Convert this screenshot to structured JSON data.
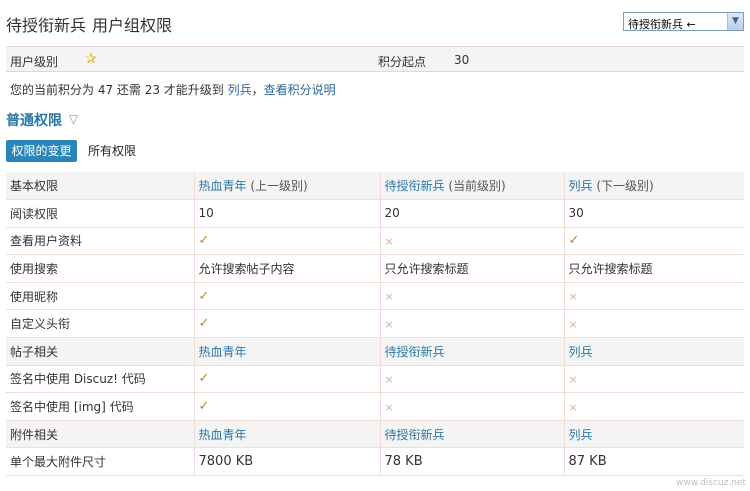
{
  "header": {
    "title": "待授衔新兵",
    "subtitle": "用户组权限",
    "group_select": {
      "value": "待授衔新兵 ←",
      "arrow": "▼"
    }
  },
  "info": {
    "level_label": "用户级别",
    "level_icon": "star-icon",
    "points_start_label": "积分起点",
    "points_start_value": "30"
  },
  "progress": {
    "prefix": "您的当前积分为 47 还需 23 才能升级到",
    "next_group": "列兵",
    "sep": "，",
    "help_link": "查看积分说明"
  },
  "section": {
    "title": "普通权限",
    "toggle_icon": "▽"
  },
  "tabs": [
    {
      "label": "权限的变更",
      "active": true
    },
    {
      "label": "所有权限",
      "active": false
    }
  ],
  "table": {
    "rows": [
      {
        "type": "header",
        "cells": [
          {
            "text": "基本权限"
          },
          {
            "text": "热血青年",
            "note": " (上一级别)"
          },
          {
            "text": "待授衔新兵",
            "note": " (当前级别)"
          },
          {
            "text": "列兵",
            "note": " (下一级别)"
          }
        ]
      },
      {
        "type": "data",
        "cells": [
          {
            "text": "阅读权限"
          },
          {
            "text": "10"
          },
          {
            "text": "20"
          },
          {
            "text": "30"
          }
        ]
      },
      {
        "type": "data",
        "cells": [
          {
            "text": "查看用户资料"
          },
          {
            "mark": "yes"
          },
          {
            "mark": "no"
          },
          {
            "mark": "yes"
          }
        ]
      },
      {
        "type": "data",
        "cells": [
          {
            "text": "使用搜索"
          },
          {
            "text": "允许搜索帖子内容"
          },
          {
            "text": "只允许搜索标题"
          },
          {
            "text": "只允许搜索标题"
          }
        ]
      },
      {
        "type": "data",
        "cells": [
          {
            "text": "使用昵称"
          },
          {
            "mark": "yes"
          },
          {
            "mark": "no"
          },
          {
            "mark": "no"
          }
        ]
      },
      {
        "type": "data",
        "cells": [
          {
            "text": "自定义头衔"
          },
          {
            "mark": "yes"
          },
          {
            "mark": "no"
          },
          {
            "mark": "no"
          }
        ]
      },
      {
        "type": "header",
        "cells": [
          {
            "text": "帖子相关"
          },
          {
            "text": "热血青年"
          },
          {
            "text": "待授衔新兵"
          },
          {
            "text": "列兵"
          }
        ]
      },
      {
        "type": "data",
        "cells": [
          {
            "text": "签名中使用 Discuz! 代码"
          },
          {
            "mark": "yes"
          },
          {
            "mark": "no"
          },
          {
            "mark": "no"
          }
        ]
      },
      {
        "type": "data",
        "cells": [
          {
            "text": "签名中使用 [img] 代码"
          },
          {
            "mark": "yes"
          },
          {
            "mark": "no"
          },
          {
            "mark": "no"
          }
        ]
      },
      {
        "type": "header",
        "cells": [
          {
            "text": "附件相关"
          },
          {
            "text": "热血青年"
          },
          {
            "text": "待授衔新兵"
          },
          {
            "text": "列兵"
          }
        ]
      },
      {
        "type": "data",
        "cells": [
          {
            "text": "单个最大附件尺寸"
          },
          {
            "text": "7800 KB",
            "big": true
          },
          {
            "text": "78 KB",
            "big": true
          },
          {
            "text": "87 KB",
            "big": true
          }
        ]
      }
    ]
  },
  "marks": {
    "yes": "✓",
    "no": "×"
  },
  "watermark": "www.discuz.net"
}
